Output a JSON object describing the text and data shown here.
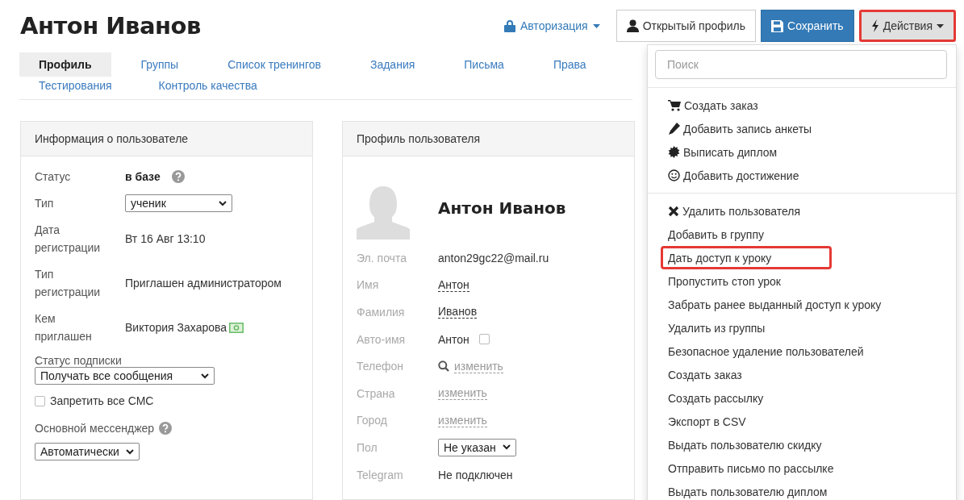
{
  "page_title": "Антон Иванов",
  "header_actions": [
    {
      "kind": "dropdown-link",
      "label": "Авторизация",
      "highlighted": false
    },
    {
      "kind": "user",
      "label": "Открытый профиль",
      "highlighted": false
    },
    {
      "kind": "save",
      "label": "Сохранить",
      "highlighted": false
    },
    {
      "kind": "actions",
      "label": "Действия",
      "highlighted": true
    }
  ],
  "tabs": [
    [
      {
        "label": "Профиль",
        "selected": true
      },
      {
        "label": "Группы",
        "selected": false
      },
      {
        "label": "Список тренингов",
        "selected": false
      },
      {
        "label": "Задания",
        "selected": false
      },
      {
        "label": "Письма",
        "selected": false
      },
      {
        "label": "Права",
        "selected": false
      }
    ],
    [
      {
        "label": "Тестирования",
        "selected": false
      },
      {
        "label": "Контроль качества",
        "selected": false
      }
    ]
  ],
  "user_info": {
    "title": "Информация о пользователе",
    "rows": [
      {
        "kind": "status",
        "label": "Статус",
        "value": "в базе"
      },
      {
        "kind": "select",
        "label": "Тип",
        "value": "ученик"
      },
      {
        "kind": "text",
        "label": "Дата регистрации",
        "value": "Вт 16 Авг 13:10"
      },
      {
        "kind": "text",
        "label": "Тип регистрации",
        "value": "Приглашен администратором"
      },
      {
        "kind": "inviter",
        "label": "Кем приглашен",
        "value": "Виктория Захарова"
      }
    ],
    "subscription": {
      "label": "Статус подписки",
      "value": "Получать все сообщения"
    },
    "sms_block": {
      "label": "Запретить все СМС",
      "checked": false
    },
    "messenger": {
      "label": "Основной мессенджер",
      "value": "Автоматически"
    }
  },
  "user_profile": {
    "title": "Профиль пользователя",
    "name": "Антон Иванов",
    "fields": [
      {
        "kind": "text",
        "label": "Эл. почта",
        "value": "anton29gc22@mail.ru"
      },
      {
        "kind": "editable",
        "label": "Имя",
        "value": "Антон"
      },
      {
        "kind": "editable",
        "label": "Фамилия",
        "value": "Иванов"
      },
      {
        "kind": "checkbox",
        "label": "Авто-имя",
        "value": "Антон",
        "checked": false
      },
      {
        "kind": "search-link",
        "label": "Телефон",
        "value": "изменить"
      },
      {
        "kind": "link",
        "label": "Страна",
        "value": "изменить"
      },
      {
        "kind": "link",
        "label": "Город",
        "value": "изменить"
      },
      {
        "kind": "select",
        "label": "Пол",
        "value": "Не указан"
      },
      {
        "kind": "text",
        "label": "Telegram",
        "value": "Не подключен"
      }
    ]
  },
  "actions_menu": {
    "search": {
      "placeholder": "Поиск"
    },
    "groups": [
      [
        {
          "kind": "cart",
          "label": "Создать заказ",
          "highlighted": false
        },
        {
          "kind": "pencil",
          "label": "Добавить запись анкеты",
          "highlighted": false
        },
        {
          "kind": "badge",
          "label": "Выписать диплом",
          "highlighted": false
        },
        {
          "kind": "smiley",
          "label": "Добавить достижение",
          "highlighted": false
        }
      ],
      [
        {
          "kind": "cross",
          "label": "Удалить пользователя",
          "highlighted": false
        },
        {
          "kind": "plain",
          "label": "Добавить в группу",
          "highlighted": false
        },
        {
          "kind": "plain",
          "label": "Дать доступ к уроку",
          "highlighted": true
        },
        {
          "kind": "plain",
          "label": "Пропустить стоп урок",
          "highlighted": false
        },
        {
          "kind": "plain",
          "label": "Забрать ранее выданный доступ к уроку",
          "highlighted": false
        },
        {
          "kind": "plain",
          "label": "Удалить из группы",
          "highlighted": false
        },
        {
          "kind": "plain",
          "label": "Безопасное удаление пользователей",
          "highlighted": false
        },
        {
          "kind": "plain",
          "label": "Создать заказ",
          "highlighted": false
        },
        {
          "kind": "plain",
          "label": "Создать рассылку",
          "highlighted": false
        },
        {
          "kind": "plain",
          "label": "Экспорт в CSV",
          "highlighted": false
        },
        {
          "kind": "plain",
          "label": "Выдать пользователю скидку",
          "highlighted": false
        },
        {
          "kind": "plain",
          "label": "Отправить письмо по рассылке",
          "highlighted": false
        },
        {
          "kind": "plain",
          "label": "Выдать пользователю диплом",
          "highlighted": false
        }
      ]
    ]
  }
}
